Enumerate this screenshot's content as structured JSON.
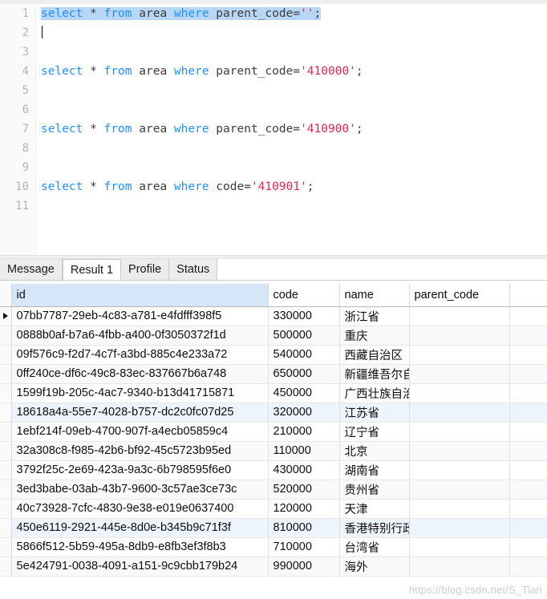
{
  "editor": {
    "gutter_numbers": [
      "1",
      "2",
      "3",
      "4",
      "5",
      "6",
      "7",
      "8",
      "9",
      "10",
      "11"
    ],
    "lines": [
      {
        "n": 1,
        "selected": true,
        "caret": false,
        "tokens": [
          {
            "t": "select",
            "c": "kw"
          },
          {
            "t": " ",
            "c": "op"
          },
          {
            "t": "*",
            "c": "star"
          },
          {
            "t": " ",
            "c": "op"
          },
          {
            "t": "from",
            "c": "kw"
          },
          {
            "t": " ",
            "c": "op"
          },
          {
            "t": "area",
            "c": "id"
          },
          {
            "t": " ",
            "c": "op"
          },
          {
            "t": "where",
            "c": "kw"
          },
          {
            "t": " ",
            "c": "op"
          },
          {
            "t": "parent_code",
            "c": "id"
          },
          {
            "t": "=",
            "c": "op"
          },
          {
            "t": "''",
            "c": "str"
          },
          {
            "t": ";",
            "c": "op"
          }
        ],
        "text": "select * from area where parent_code='';"
      },
      {
        "n": 2,
        "selected": false,
        "caret": true,
        "tokens": [],
        "text": ""
      },
      {
        "n": 3,
        "selected": false,
        "caret": false,
        "tokens": [],
        "text": ""
      },
      {
        "n": 4,
        "selected": false,
        "caret": false,
        "tokens": [
          {
            "t": "select",
            "c": "kw"
          },
          {
            "t": " ",
            "c": "op"
          },
          {
            "t": "*",
            "c": "star"
          },
          {
            "t": " ",
            "c": "op"
          },
          {
            "t": "from",
            "c": "kw"
          },
          {
            "t": " ",
            "c": "op"
          },
          {
            "t": "area",
            "c": "id"
          },
          {
            "t": " ",
            "c": "op"
          },
          {
            "t": "where",
            "c": "kw"
          },
          {
            "t": " ",
            "c": "op"
          },
          {
            "t": "parent_code",
            "c": "id"
          },
          {
            "t": "=",
            "c": "op"
          },
          {
            "t": "'410000'",
            "c": "str"
          },
          {
            "t": ";",
            "c": "op"
          }
        ],
        "text": "select * from area where parent_code='410000';"
      },
      {
        "n": 5,
        "selected": false,
        "caret": false,
        "tokens": [],
        "text": ""
      },
      {
        "n": 6,
        "selected": false,
        "caret": false,
        "tokens": [],
        "text": ""
      },
      {
        "n": 7,
        "selected": false,
        "caret": false,
        "tokens": [
          {
            "t": "select",
            "c": "kw"
          },
          {
            "t": " ",
            "c": "op"
          },
          {
            "t": "*",
            "c": "star"
          },
          {
            "t": " ",
            "c": "op"
          },
          {
            "t": "from",
            "c": "kw"
          },
          {
            "t": " ",
            "c": "op"
          },
          {
            "t": "area",
            "c": "id"
          },
          {
            "t": " ",
            "c": "op"
          },
          {
            "t": "where",
            "c": "kw"
          },
          {
            "t": " ",
            "c": "op"
          },
          {
            "t": "parent_code",
            "c": "id"
          },
          {
            "t": "=",
            "c": "op"
          },
          {
            "t": "'410900'",
            "c": "str"
          },
          {
            "t": ";",
            "c": "op"
          }
        ],
        "text": "select * from area where parent_code='410900';"
      },
      {
        "n": 8,
        "selected": false,
        "caret": false,
        "tokens": [],
        "text": ""
      },
      {
        "n": 9,
        "selected": false,
        "caret": false,
        "tokens": [],
        "text": ""
      },
      {
        "n": 10,
        "selected": false,
        "caret": false,
        "tokens": [
          {
            "t": "select",
            "c": "kw"
          },
          {
            "t": " ",
            "c": "op"
          },
          {
            "t": "*",
            "c": "star"
          },
          {
            "t": " ",
            "c": "op"
          },
          {
            "t": "from",
            "c": "kw"
          },
          {
            "t": " ",
            "c": "op"
          },
          {
            "t": "area",
            "c": "id"
          },
          {
            "t": " ",
            "c": "op"
          },
          {
            "t": "where",
            "c": "kw"
          },
          {
            "t": " ",
            "c": "op"
          },
          {
            "t": "code",
            "c": "id"
          },
          {
            "t": "=",
            "c": "op"
          },
          {
            "t": "'410901'",
            "c": "str"
          },
          {
            "t": ";",
            "c": "op"
          }
        ],
        "text": "select * from area where code='410901';"
      },
      {
        "n": 11,
        "selected": false,
        "caret": false,
        "tokens": [],
        "text": ""
      }
    ],
    "colors": {
      "keyword": "#1e90ff",
      "string": "#e8254d",
      "identifier": "#3c3c3c",
      "selection": "#b8d6f5",
      "line_number": "#b5b5b5"
    }
  },
  "tabs": [
    {
      "label": "Message",
      "active": false
    },
    {
      "label": "Result 1",
      "active": true
    },
    {
      "label": "Profile",
      "active": false
    },
    {
      "label": "Status",
      "active": false
    }
  ],
  "result_grid": {
    "columns": [
      "id",
      "code",
      "name",
      "parent_code"
    ],
    "selected_column": "id",
    "current_row_index": 0,
    "rows": [
      {
        "id": "07bb7787-29eb-4c83-a781-e4fdfff398f5",
        "code": "330000",
        "name": "浙江省",
        "parent_code": ""
      },
      {
        "id": "0888b0af-b7a6-4fbb-a400-0f3050372f1d",
        "code": "500000",
        "name": "重庆",
        "parent_code": ""
      },
      {
        "id": "09f576c9-f2d7-4c7f-a3bd-885c4e233a72",
        "code": "540000",
        "name": "西藏自治区",
        "parent_code": ""
      },
      {
        "id": "0ff240ce-df6c-49c8-83ec-837667b6a748",
        "code": "650000",
        "name": "新疆维吾尔自治区",
        "parent_code": ""
      },
      {
        "id": "1599f19b-205c-4ac7-9340-b13d41715871",
        "code": "450000",
        "name": "广西壮族自治区",
        "parent_code": ""
      },
      {
        "id": "18618a4a-55e7-4028-b757-dc2c0fc07d25",
        "code": "320000",
        "name": "江苏省",
        "parent_code": ""
      },
      {
        "id": "1ebf214f-09eb-4700-907f-a4ecb05859c4",
        "code": "210000",
        "name": "辽宁省",
        "parent_code": ""
      },
      {
        "id": "32a308c8-f985-42b6-bf92-45c5723b95ed",
        "code": "110000",
        "name": "北京",
        "parent_code": ""
      },
      {
        "id": "3792f25c-2e69-423a-9a3c-6b798595f6e0",
        "code": "430000",
        "name": "湖南省",
        "parent_code": ""
      },
      {
        "id": "3ed3babe-03ab-43b7-9600-3c57ae3ce73c",
        "code": "520000",
        "name": "贵州省",
        "parent_code": ""
      },
      {
        "id": "40c73928-7cfc-4830-9e38-e019e0637400",
        "code": "120000",
        "name": "天津",
        "parent_code": ""
      },
      {
        "id": "450e6119-2921-445e-8d0e-b345b9c71f3f",
        "code": "810000",
        "name": "香港特别行政区",
        "parent_code": ""
      },
      {
        "id": "5866f512-5b59-495a-8db9-e8fb3ef3f8b3",
        "code": "710000",
        "name": "台湾省",
        "parent_code": ""
      },
      {
        "id": "5e424791-0038-4091-a151-9c9cbb179b24",
        "code": "990000",
        "name": "海外",
        "parent_code": ""
      }
    ]
  },
  "watermark": {
    "text": "https://blog.csdn.net/S_Tian"
  }
}
